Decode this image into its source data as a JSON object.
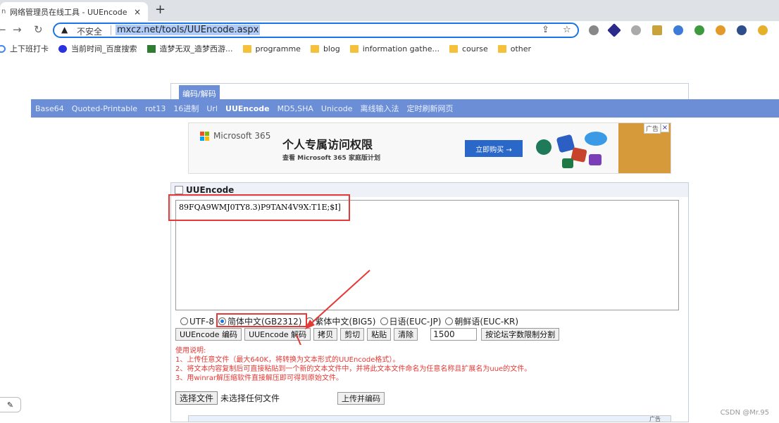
{
  "browser": {
    "tab_title": "网络管理员在线工具 - UUEncode",
    "tab_close": "×",
    "new_tab": "+",
    "security_label": "不安全",
    "url": "mxcz.net/tools/UUEncode.aspx"
  },
  "bookmarks": [
    {
      "label": "上下班打卡",
      "icon": "clock-icon"
    },
    {
      "label": "当前时间_百度搜索",
      "icon": "baidu-paw-icon"
    },
    {
      "label": "造梦无双_造梦西游...",
      "icon": "game-icon"
    },
    {
      "label": "programme",
      "icon": "folder-icon"
    },
    {
      "label": "blog",
      "icon": "folder-icon"
    },
    {
      "label": "information gathe...",
      "icon": "folder-icon"
    },
    {
      "label": "course",
      "icon": "folder-icon"
    },
    {
      "label": "other",
      "icon": "folder-icon"
    }
  ],
  "site": {
    "section_tab": "编码/解码",
    "nav": [
      {
        "label": "Base64",
        "active": false
      },
      {
        "label": "Quoted-Printable",
        "active": false
      },
      {
        "label": "rot13",
        "active": false
      },
      {
        "label": "16进制",
        "active": false
      },
      {
        "label": "Url",
        "active": false
      },
      {
        "label": "UUEncode",
        "active": true
      },
      {
        "label": "MD5,SHA",
        "active": false
      },
      {
        "label": "Unicode",
        "active": false
      },
      {
        "label": "离线输入法",
        "active": false
      },
      {
        "label": "定时刷新网页",
        "active": false
      }
    ]
  },
  "ad": {
    "brand": "Microsoft 365",
    "title": "个人专属访问权限",
    "subtitle": "查看 Microsoft 365 家庭版计划",
    "cta": "立即购买 →",
    "badge": "广告",
    "close": "×"
  },
  "panel": {
    "title": "UUEncode",
    "text_value": "89FQA9WMJ0TY8.3)P9TAN4V9X:T1E;$I]",
    "encodings": [
      {
        "label": "UTF-8",
        "checked": false
      },
      {
        "label": "简体中文(GB2312)",
        "checked": true
      },
      {
        "label": "繁体中文(BIG5)",
        "checked": false
      },
      {
        "label": "日语(EUC-JP)",
        "checked": false
      },
      {
        "label": "朝鲜语(EUC-KR)",
        "checked": false
      }
    ],
    "buttons": {
      "encode": "UUEncode 编码",
      "decode": "UUEncode 解码",
      "copy": "拷贝",
      "cut": "剪切",
      "paste": "粘贴",
      "clear": "清除",
      "split_value": "1500",
      "split": "按论坛字数限制分割"
    },
    "usage": {
      "heading": "使用说明:",
      "lines": [
        "1、上传任意文件（最大640K，将转换为文本形式的UUEncode格式）。",
        "2、将文本内容复制后可直接粘贴到一个新的文本文件中，并将此文本文件命名为任意名称且扩展名为uue的文件。",
        "3、用winrar解压缩软件直接解压即可得到原始文件。"
      ]
    },
    "file": {
      "choose": "选择文件",
      "status": "未选择任何文件",
      "upload": "上传并编码"
    }
  },
  "watermark": "CSDN @Mr.95",
  "bottom_ad_badge": "广告"
}
